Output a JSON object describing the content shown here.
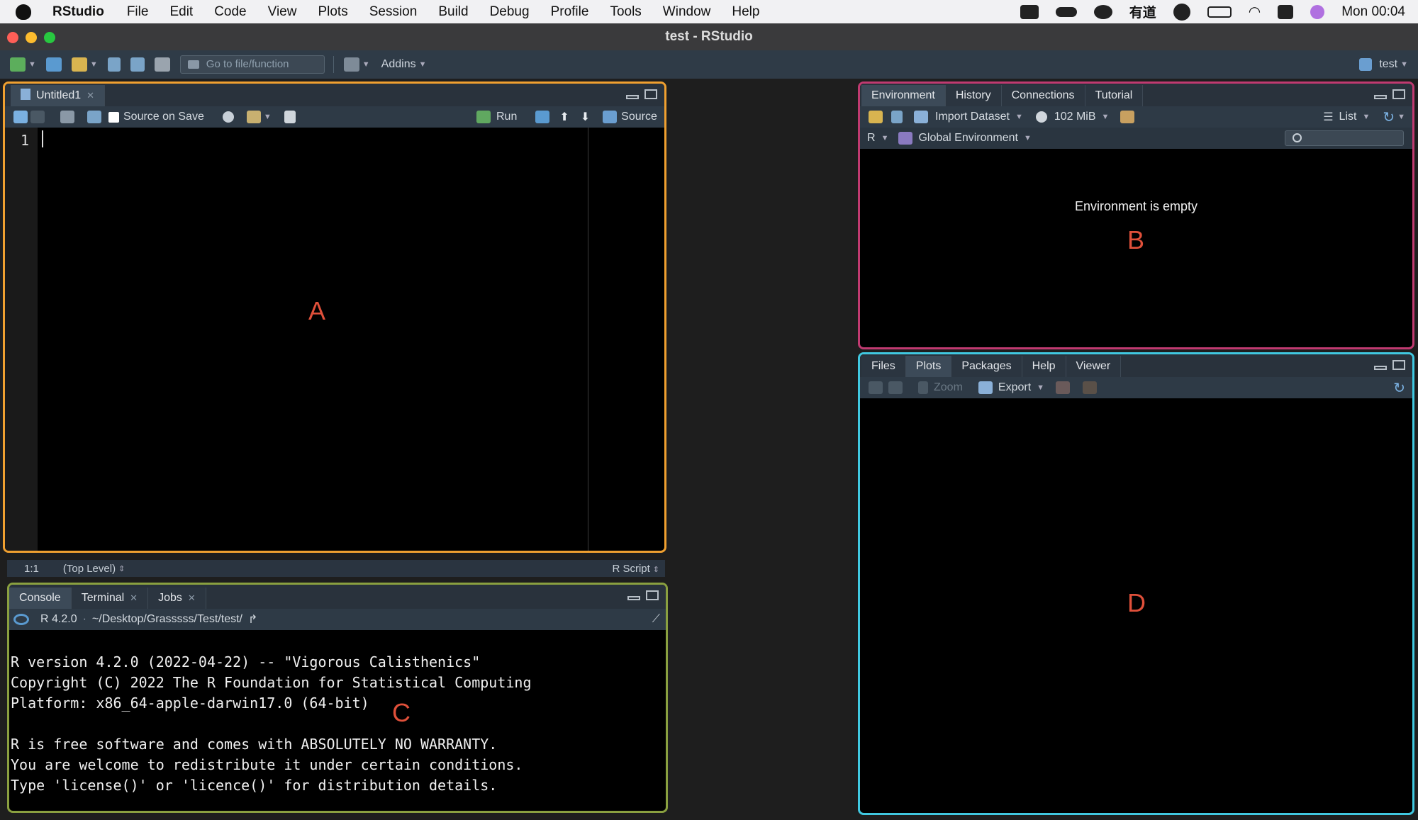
{
  "menubar": {
    "app_name": "RStudio",
    "items": [
      "File",
      "Edit",
      "Code",
      "View",
      "Plots",
      "Session",
      "Build",
      "Debug",
      "Profile",
      "Tools",
      "Window",
      "Help"
    ],
    "clock": "Mon 00:04",
    "youdao": "有道"
  },
  "window": {
    "title": "test - RStudio"
  },
  "toolbar": {
    "goto_placeholder": "Go to file/function",
    "addins_label": "Addins",
    "project_label": "test"
  },
  "source": {
    "tab_label": "Untitled1",
    "source_on_save": "Source on Save",
    "run_label": "Run",
    "source_label": "Source",
    "line_number": "1",
    "status_position": "1:1",
    "status_scope": "(Top Level)",
    "status_filetype": "R Script",
    "marker": "A"
  },
  "console": {
    "tabs": [
      "Console",
      "Terminal",
      "Jobs"
    ],
    "r_version": "R 4.2.0",
    "path": "~/Desktop/Grasssss/Test/test/",
    "lines": [
      "",
      "R version 4.2.0 (2022-04-22) -- \"Vigorous Calisthenics\"",
      "Copyright (C) 2022 The R Foundation for Statistical Computing",
      "Platform: x86_64-apple-darwin17.0 (64-bit)",
      "",
      "R is free software and comes with ABSOLUTELY NO WARRANTY.",
      "You are welcome to redistribute it under certain conditions.",
      "Type 'license()' or 'licence()' for distribution details."
    ],
    "marker": "C"
  },
  "environment": {
    "tabs": [
      "Environment",
      "History",
      "Connections",
      "Tutorial"
    ],
    "import_label": "Import Dataset",
    "memory_label": "102 MiB",
    "list_label": "List",
    "r_label": "R",
    "env_label": "Global Environment",
    "empty_message": "Environment is empty",
    "marker": "B"
  },
  "files": {
    "tabs": [
      "Files",
      "Plots",
      "Packages",
      "Help",
      "Viewer"
    ],
    "zoom_label": "Zoom",
    "export_label": "Export",
    "marker": "D"
  },
  "colors": {
    "source_border": "#f0a030",
    "env_border": "#c03a70",
    "console_border": "#8aa040",
    "files_border": "#40c8e0",
    "marker_red": "#e0503a"
  }
}
